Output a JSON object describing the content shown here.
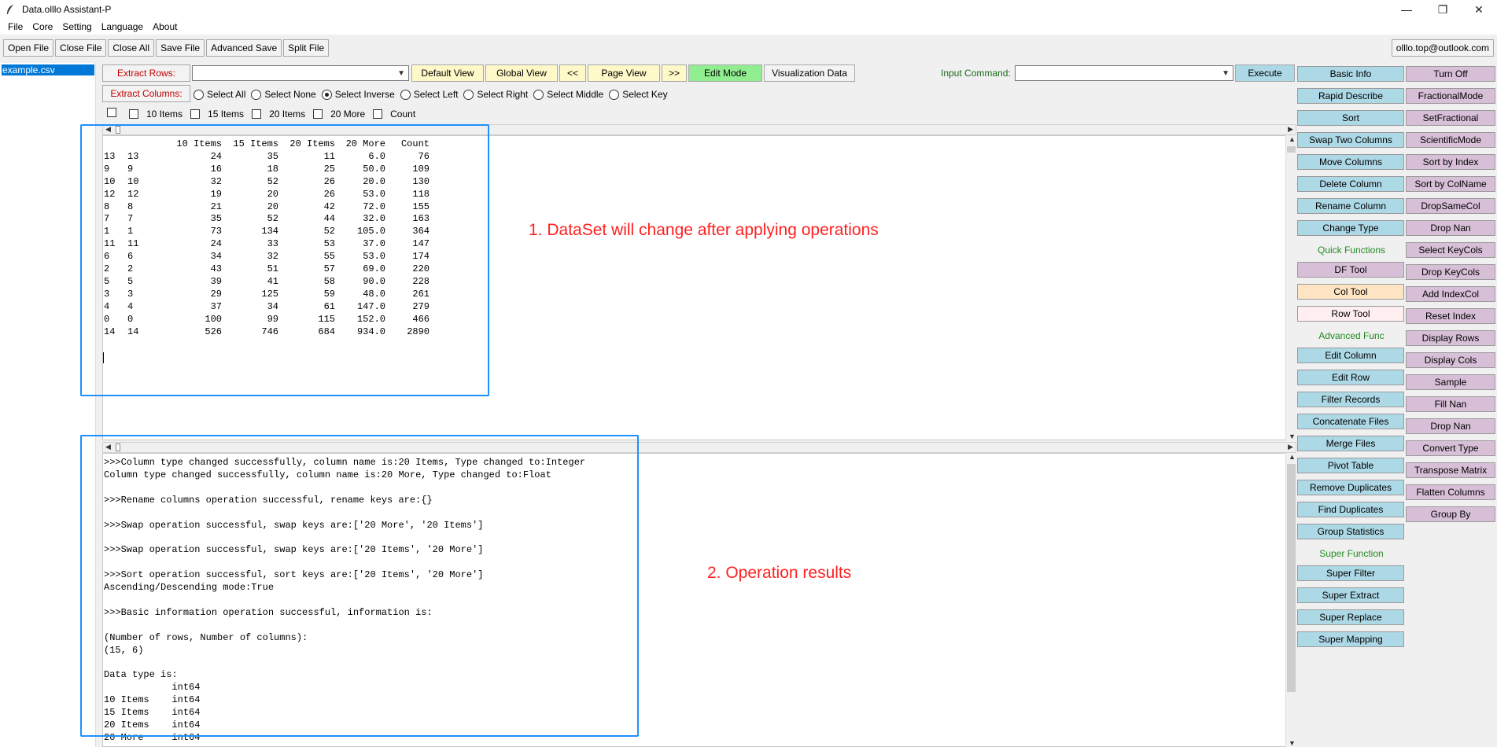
{
  "window": {
    "title": "Data.olllo Assistant-P",
    "minimize": "—",
    "maximize": "❐",
    "close": "✕"
  },
  "menu": [
    "File",
    "Core",
    "Setting",
    "Language",
    "About"
  ],
  "toolbar": [
    "Open File",
    "Close File",
    "Close All",
    "Save File",
    "Advanced Save",
    "Split File"
  ],
  "account": "olllo.top@outlook.com",
  "files": [
    "example.csv"
  ],
  "controls": {
    "extract_rows": "Extract Rows:",
    "extract_columns": "Extract Columns:",
    "extract_rows_value": "",
    "default_view": "Default View",
    "global_view": "Global View",
    "prev": "<<",
    "page_view": "Page View",
    "next": ">>",
    "edit_mode": "Edit Mode",
    "visualization": "Visualization Data",
    "input_command": "Input Command:",
    "input_command_value": "",
    "execute": "Execute"
  },
  "radios": [
    {
      "label": "Select All",
      "on": false
    },
    {
      "label": "Select None",
      "on": false
    },
    {
      "label": "Select Inverse",
      "on": true
    },
    {
      "label": "Select Left",
      "on": false
    },
    {
      "label": "Select Right",
      "on": false
    },
    {
      "label": "Select Middle",
      "on": false
    },
    {
      "label": "Select Key",
      "on": false
    }
  ],
  "checkboxes": [
    "10 Items",
    "15 Items",
    "20 Items",
    "20 More",
    "Count"
  ],
  "dataset": {
    "header": [
      "",
      "10 Items",
      "15 Items",
      "20 Items",
      "20 More",
      "Count"
    ],
    "rows": [
      [
        "13",
        "13",
        "24",
        "35",
        "11",
        "6.0",
        "76"
      ],
      [
        "9",
        "9",
        "16",
        "18",
        "25",
        "50.0",
        "109"
      ],
      [
        "10",
        "10",
        "32",
        "52",
        "26",
        "20.0",
        "130"
      ],
      [
        "12",
        "12",
        "19",
        "20",
        "26",
        "53.0",
        "118"
      ],
      [
        "8",
        "8",
        "21",
        "20",
        "42",
        "72.0",
        "155"
      ],
      [
        "7",
        "7",
        "35",
        "52",
        "44",
        "32.0",
        "163"
      ],
      [
        "1",
        "1",
        "73",
        "134",
        "52",
        "105.0",
        "364"
      ],
      [
        "11",
        "11",
        "24",
        "33",
        "53",
        "37.0",
        "147"
      ],
      [
        "6",
        "6",
        "34",
        "32",
        "55",
        "53.0",
        "174"
      ],
      [
        "2",
        "2",
        "43",
        "51",
        "57",
        "69.0",
        "220"
      ],
      [
        "5",
        "5",
        "39",
        "41",
        "58",
        "90.0",
        "228"
      ],
      [
        "3",
        "3",
        "29",
        "125",
        "59",
        "48.0",
        "261"
      ],
      [
        "4",
        "4",
        "37",
        "34",
        "61",
        "147.0",
        "279"
      ],
      [
        "0",
        "0",
        "100",
        "99",
        "115",
        "152.0",
        "466"
      ],
      [
        "14",
        "14",
        "526",
        "746",
        "684",
        "934.0",
        "2890"
      ]
    ]
  },
  "log_lines": [
    ">>>Column type changed successfully, column name is:20 Items, Type changed to:Integer",
    "Column type changed successfully, column name is:20 More, Type changed to:Float",
    "",
    ">>>Rename columns operation successful, rename keys are:{}",
    "",
    ">>>Swap operation successful, swap keys are:['20 More', '20 Items']",
    "",
    ">>>Swap operation successful, swap keys are:['20 Items', '20 More']",
    "",
    ">>>Sort operation successful, sort keys are:['20 Items', '20 More']",
    "Ascending/Descending mode:True",
    "",
    ">>>Basic information operation successful, information is:",
    "",
    "(Number of rows, Number of columns):",
    "(15, 6)",
    "",
    "Data type is:",
    "            int64",
    "10 Items    int64",
    "15 Items    int64",
    "20 Items    int64",
    "20 More     int64"
  ],
  "annotations": {
    "dataset_note": "1. DataSet will change after applying operations",
    "results_note": "2. Operation results"
  },
  "panel_left": [
    {
      "label": "Basic Info",
      "kind": "blue"
    },
    {
      "label": "Rapid Describe",
      "kind": "blue"
    },
    {
      "label": "Sort",
      "kind": "blue"
    },
    {
      "label": "Swap Two Columns",
      "kind": "blue"
    },
    {
      "label": "Move Columns",
      "kind": "blue"
    },
    {
      "label": "Delete Column",
      "kind": "blue"
    },
    {
      "label": "Rename Column",
      "kind": "blue"
    },
    {
      "label": "Change Type",
      "kind": "blue"
    },
    {
      "label": "Quick Functions",
      "kind": "label"
    },
    {
      "label": "DF Tool",
      "kind": "violet"
    },
    {
      "label": "Col Tool",
      "kind": "peach"
    },
    {
      "label": "Row Tool",
      "kind": "pink"
    },
    {
      "label": "Advanced Func",
      "kind": "label"
    },
    {
      "label": "Edit Column",
      "kind": "blue"
    },
    {
      "label": "Edit Row",
      "kind": "blue"
    },
    {
      "label": "Filter Records",
      "kind": "blue"
    },
    {
      "label": "Concatenate Files",
      "kind": "blue"
    },
    {
      "label": "Merge Files",
      "kind": "blue"
    },
    {
      "label": "Pivot Table",
      "kind": "blue"
    },
    {
      "label": "Remove Duplicates",
      "kind": "blue"
    },
    {
      "label": "Find Duplicates",
      "kind": "blue"
    },
    {
      "label": "Group Statistics",
      "kind": "blue"
    },
    {
      "label": "Super Function",
      "kind": "label"
    },
    {
      "label": "Super Filter",
      "kind": "blue"
    },
    {
      "label": "Super Extract",
      "kind": "blue"
    },
    {
      "label": "Super Replace",
      "kind": "blue"
    },
    {
      "label": "Super Mapping",
      "kind": "blue"
    }
  ],
  "panel_right": [
    "Turn Off",
    "FractionalMode",
    "SetFractional",
    "ScientificMode",
    "Sort by Index",
    "Sort by ColName",
    "DropSameCol",
    "Drop Nan",
    "Select KeyCols",
    "Drop KeyCols",
    "Add IndexCol",
    "Reset Index",
    "Display Rows",
    "Display Cols",
    "Sample",
    "Fill Nan",
    "Drop Nan",
    "Convert Type",
    "Transpose Matrix",
    "Flatten Columns",
    "Group By"
  ],
  "colors": {
    "blue_button": "#add8e6",
    "violet_button": "#d8bfd8",
    "peach_button": "#ffe4c4",
    "pink_button": "#ffeef0",
    "edit_mode": "#90ee90",
    "nav_buttons": "#fff8c8",
    "annotation_box": "#1e90ff",
    "annotation_text": "#ff2020",
    "selection": "#0078d7"
  }
}
